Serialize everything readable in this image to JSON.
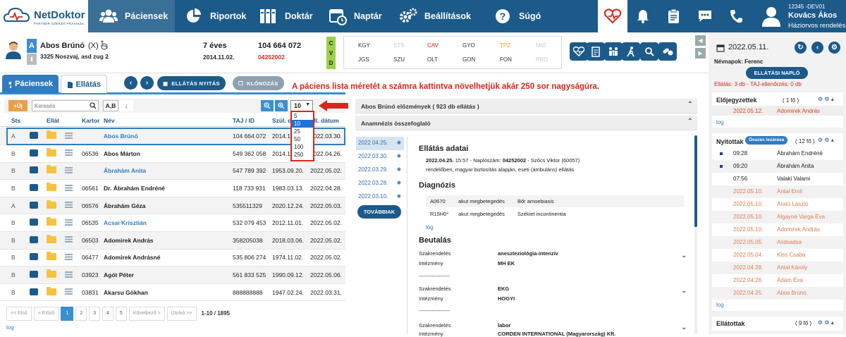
{
  "app": {
    "name": "NetDoktor",
    "tagline": "PARTNER SZERZŐ PRAXISZIL"
  },
  "nav": {
    "items": [
      {
        "label": "Páciensek"
      },
      {
        "label": "Riportok"
      },
      {
        "label": "Doktár"
      },
      {
        "label": "Naptár"
      },
      {
        "label": "Beállítások"
      },
      {
        "label": "Súgó"
      }
    ]
  },
  "user": {
    "code": "12345 -DEV01",
    "name": "Kovács Ákos",
    "role": "Háziorvos rendelés"
  },
  "patient": {
    "badge": "A",
    "name": "Abos Brúnó",
    "suffix": "(X)",
    "address": "3325 Noszvaj, asd zug 2",
    "age": "7 éves",
    "birthdate": "2014.11.02.",
    "taj": "104 664 072",
    "taj_sub": "04252002",
    "cvd": [
      "C",
      "V",
      "D"
    ]
  },
  "codes": {
    "row1": [
      {
        "t": "KGY",
        "d": false
      },
      {
        "t": "STS",
        "d": true
      },
      {
        "t": "CAV",
        "d": false,
        "c": "#d9261c"
      },
      {
        "t": "GYO",
        "d": false
      },
      {
        "t": "TPZ",
        "d": false,
        "c": "#f29b1d"
      },
      {
        "t": "MID",
        "d": true
      }
    ],
    "row2": [
      {
        "t": "JGS",
        "d": false
      },
      {
        "t": "SZU",
        "d": false
      },
      {
        "t": "OLT",
        "d": false
      },
      {
        "t": "GON",
        "d": false
      },
      {
        "t": "FON",
        "d": false
      },
      {
        "t": "PRD",
        "d": true
      }
    ]
  },
  "tabs": {
    "patients": "Páciensek",
    "care": "Ellátás"
  },
  "toolbar": {
    "open": "ELLÁTÁS NYITÁS",
    "clone": "KLÓNOZÁS"
  },
  "annotation": "A páciens lista méretét a számra kattintva növelhetjük akár 250 sor nagyságúra.",
  "list": {
    "new_label": "+Új",
    "search_placeholder": "Keresés",
    "sort_label": "A,B",
    "page_size": "10",
    "page_size_options": [
      "5",
      "10",
      "25",
      "50",
      "100",
      "250"
    ],
    "headers": {
      "sts": "Sts",
      "ellat": "Ellát",
      "kartor": "Kartor",
      "nev": "Név",
      "taj": "TAJ / ID",
      "szul": "Szül. d",
      "datum": "Ell. dátum"
    },
    "rows": [
      {
        "sts": "A",
        "kartor": "",
        "name": "Abos Brúnó",
        "taj": "104 664 072",
        "szul": "2014.11.",
        "date": "2022.03.30.",
        "link": true
      },
      {
        "sts": "B",
        "kartor": "06536",
        "name": "Abos Márton",
        "taj": "549 362 058",
        "szul": "2014.11.",
        "date": "2022.04.26.",
        "link": false
      },
      {
        "sts": "B",
        "kartor": "",
        "name": "Ábrahám Anita",
        "taj": "547 789 392",
        "szul": "1953.09.20.",
        "date": "2022.05.02.",
        "link": true
      },
      {
        "sts": "B",
        "kartor": "06561",
        "name": "Dr. Ábrahám Endréné",
        "taj": "118 733 931",
        "szul": "1983.03.13.",
        "date": "2022.04.28.",
        "link": false
      },
      {
        "sts": "A",
        "kartor": "06576",
        "name": "Ábrahám Géza",
        "taj": "535511329",
        "szul": "2020.12.24.",
        "date": "2022.05.03.",
        "link": false
      },
      {
        "sts": "B",
        "kartor": "06535",
        "name": "Acsai Krisztián",
        "taj": "532 079 453",
        "szul": "2012.11.01.",
        "date": "2022.05.02.",
        "link": true
      },
      {
        "sts": "B",
        "kartor": "06503",
        "name": "Adomirek András",
        "taj": "358205038",
        "szul": "2018.03.06.",
        "date": "2022.05.02.",
        "link": false
      },
      {
        "sts": "B",
        "kartor": "06477",
        "name": "Adomirek Andrásné",
        "taj": "535 806 274",
        "szul": "1974.11.02.",
        "date": "2022.05.02.",
        "link": false
      },
      {
        "sts": "B",
        "kartor": "03923",
        "name": "Agót Péter",
        "taj": "561 833 525",
        "szul": "1990.09.12.",
        "date": "2022.05.06.",
        "link": false
      },
      {
        "sts": "B",
        "kartor": "03831",
        "name": "Akarsu Gökhan",
        "taj": "888888888",
        "szul": "1947.02.24.",
        "date": "2022.03.31.",
        "link": false
      }
    ],
    "pager": {
      "first": "<< Első",
      "prev": "< Előző",
      "pages": [
        "1",
        "2",
        "3",
        "4",
        "5"
      ],
      "next": "Következő >",
      "last": "Utolsó >>",
      "range": "1-10 / 1895"
    },
    "log": "log"
  },
  "center": {
    "history": "Abos Brúnó előzmények ( 923 db ellátás )",
    "anamnesis": "Anamnézis összefoglaló",
    "dates": [
      "2022.04.25.",
      "2022.03.30.",
      "2022.03.29.",
      "2022.03.28.",
      "2022.03.10."
    ],
    "more": "TOVÁBBIAK",
    "care_title": "Ellátás adatai",
    "care_line1_date": "2022.04.25.",
    "care_line1_rest": " 15:57 - Naplószám: ",
    "care_line1_no": "04252002",
    "care_line1_tail": " - Szőcs Viktor (60057)",
    "care_line2": "rendelőben, magyar biztosítás alapján, eseti (ambuláns) ellátás",
    "diag_title": "Diagnózis",
    "diags": [
      {
        "code": "A0670",
        "type": "akut megbetegedés",
        "name": "Bőr amoebiasis"
      },
      {
        "code": "R15H0*",
        "type": "akut megbetegedés",
        "name": "Székiet incontinentia"
      }
    ],
    "log": "log",
    "ref_title": "Beutalás",
    "refs": [
      {
        "k1": "Szakrendelés",
        "v1": "aneszteziológia-intenzív",
        "k2": "Intézmény",
        "v2": "MH EK"
      },
      {
        "k1": "Szakrendelés",
        "v1": "EKG",
        "k2": "Intézmény",
        "v2": "HOGYI"
      },
      {
        "k1": "Szakrendelés",
        "v1": "labor",
        "k2": "Intézmény",
        "v2": "CORDEN INTERNATIONAL (Magyarország) Kft."
      }
    ],
    "sep": "-------------------"
  },
  "right": {
    "date": "2022.05.11.",
    "nameday": "Névnapok: Ferenc",
    "naplo": "ELLÁTÁSI NAPLÓ",
    "stats": "Ellátás: 3 db - TAJ-ellenőrzés: 0 db",
    "booked": {
      "title": "Előjegyzettek",
      "count": "( 1 fő )",
      "rows": [
        {
          "date": "2022.05.12.",
          "name": "Adomirek András"
        }
      ],
      "log": "log"
    },
    "open": {
      "title": "Nyitottak",
      "close_all": "Összes lezárása",
      "count": "( 12 fő )",
      "rows": [
        {
          "t": "09:28",
          "n": "Ábrahám Endréné",
          "s": "b"
        },
        {
          "t": "09:20",
          "n": "Ábrahám Anita",
          "s": "b"
        },
        {
          "t": "07:56",
          "n": "Valaki Valami",
          "s": "n"
        },
        {
          "t": "2022.05.10.",
          "n": "Antal Emil",
          "s": "o"
        },
        {
          "t": "2022.05.10.",
          "n": "Arató László",
          "s": "o"
        },
        {
          "t": "2022.05.10.",
          "n": "Algayné Varga Éva",
          "s": "o"
        },
        {
          "t": "2022.05.10.",
          "n": "Adomirek András",
          "s": "o"
        },
        {
          "t": "2022.05.05.",
          "n": "Asdsadsa",
          "s": "o"
        },
        {
          "t": "2022.05.04.",
          "n": "Kiss Csaba",
          "s": "o"
        },
        {
          "t": "2022.04.28.",
          "n": "Antal Károly",
          "s": "o"
        },
        {
          "t": "2022.04.26.",
          "n": "Ádám Éva",
          "s": "o"
        },
        {
          "t": "2022.04.25.",
          "n": "Abos Brúnó",
          "s": "o"
        }
      ],
      "log": "log"
    },
    "done": {
      "title": "Ellátottak",
      "count": "( 9 fő )"
    }
  },
  "colors": {
    "navy": "#1c5a8a",
    "red": "#d9261c",
    "orange": "#e8a046"
  }
}
